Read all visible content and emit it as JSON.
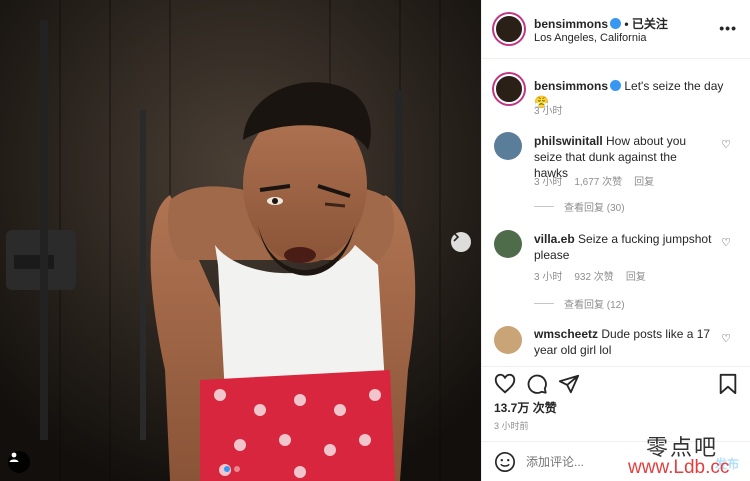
{
  "post": {
    "user": "bensimmons",
    "follow_label": "已关注",
    "location": "Los Angeles, California",
    "more_icon": "more-horizontal-icon"
  },
  "caption": {
    "user": "bensimmons",
    "text": "Let's seize the day 😤",
    "time": "3 小时"
  },
  "comments": [
    {
      "user": "philswinitall",
      "text": "How about you seize that dunk against the hawks",
      "time": "3 小时",
      "likes": "1,677 次赞",
      "reply_label": "回复",
      "view_replies": "查看回复 (30)"
    },
    {
      "user": "villa.eb",
      "text": "Seize a fucking jumpshot please",
      "time": "3 小时",
      "likes": "932 次赞",
      "reply_label": "回复",
      "view_replies": "查看回复 (12)"
    },
    {
      "user": "wmscheetz",
      "text": "Dude posts like a 17 year old girl lol",
      "time": "",
      "likes": "",
      "reply_label": "",
      "view_replies": ""
    }
  ],
  "stats": {
    "likes": "13.7万 次赞",
    "time": "3 小时前"
  },
  "composer": {
    "placeholder": "添加评论...",
    "post_label": "发布"
  },
  "carousel": {
    "slides": 2,
    "active": 1
  },
  "watermark": {
    "cn": "零点吧",
    "url": "www.Ldb.cc"
  },
  "colors": {
    "accent": "#3897f0",
    "ring": "#c13584",
    "muted": "#8e8e8e",
    "shorts": "#d7263d"
  }
}
